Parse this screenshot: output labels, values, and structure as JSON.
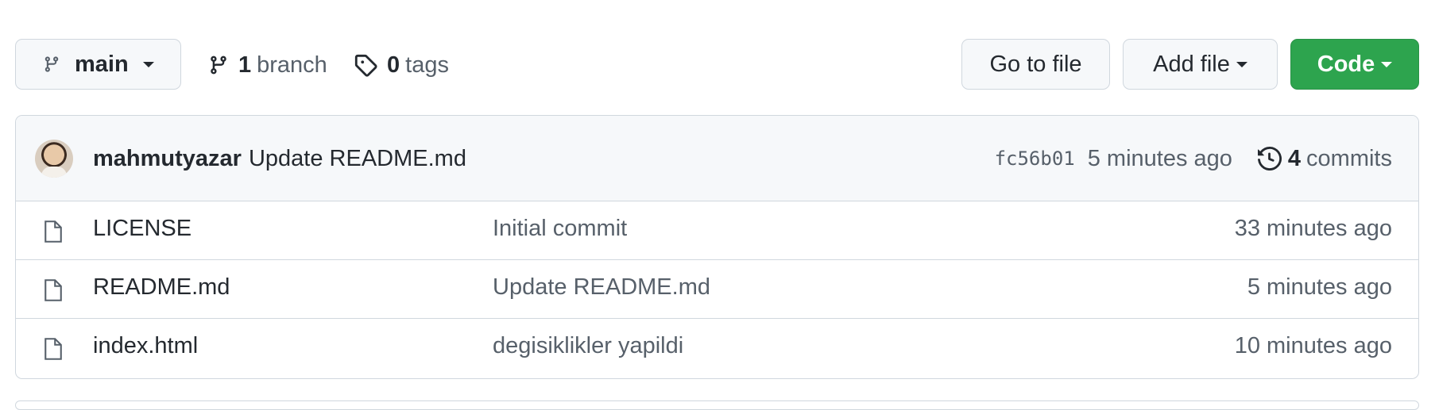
{
  "toolbar": {
    "branch_button_label": "main",
    "branches": {
      "count": "1",
      "label": "branch"
    },
    "tags": {
      "count": "0",
      "label": "tags"
    },
    "go_to_file_label": "Go to file",
    "add_file_label": "Add file",
    "code_label": "Code"
  },
  "latest_commit": {
    "author": "mahmutyazar",
    "message": "Update README.md",
    "sha": "fc56b01",
    "time": "5 minutes ago",
    "commits_count": "4",
    "commits_label": "commits"
  },
  "files": [
    {
      "name": "LICENSE",
      "commit_message": "Initial commit",
      "age": "33 minutes ago"
    },
    {
      "name": "README.md",
      "commit_message": "Update README.md",
      "age": "5 minutes ago"
    },
    {
      "name": "index.html",
      "commit_message": "degisiklikler yapildi",
      "age": "10 minutes ago"
    }
  ],
  "colors": {
    "code_button": "#2da44e",
    "border": "#d0d7de",
    "header_bg": "#f6f8fa",
    "muted_text": "#57606a"
  }
}
